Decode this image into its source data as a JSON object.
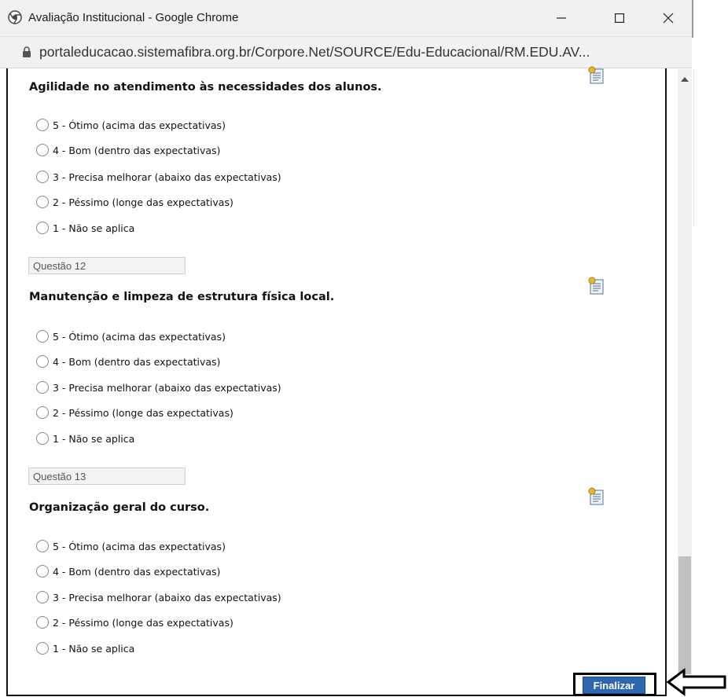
{
  "window": {
    "title": "Avaliação Institucional - Google Chrome",
    "url": "portaleducacao.sistemafibra.org.br/Corpore.Net/SOURCE/Edu-Educacional/RM.EDU.AV..."
  },
  "options": [
    "5 - Ótimo (acima das expectativas)",
    "4 - Bom (dentro das expectativas)",
    "3 - Precisa melhorar (abaixo das expectativas)",
    "2 - Péssimo (longe das expectativas)",
    "1 - Não se aplica"
  ],
  "questions": [
    {
      "label": "",
      "title": "Agilidade no atendimento às necessidades dos alunos."
    },
    {
      "label": "Questão 12",
      "title": "Manutenção e limpeza de estrutura física local."
    },
    {
      "label": "Questão 13",
      "title": "Organização geral do curso."
    }
  ],
  "finalize_label": "Finalizar"
}
